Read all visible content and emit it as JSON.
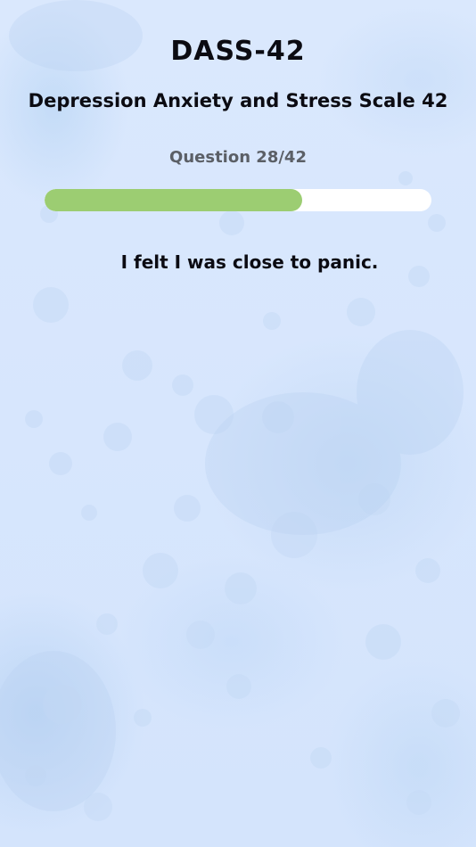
{
  "app": {
    "title": "DASS-42",
    "subtitle": "Depression Anxiety and Stress Scale 42"
  },
  "progress": {
    "label": "Question 28/42",
    "current": 28,
    "total": 42,
    "fraction": 0.6667
  },
  "question": {
    "text": "I felt I was close to panic."
  },
  "colors": {
    "background": "#d9e8fe",
    "progress_fill": "#9ccd72",
    "progress_track": "#ffffff",
    "title_text": "#0b0b12",
    "counter_text": "#5b5f66"
  }
}
